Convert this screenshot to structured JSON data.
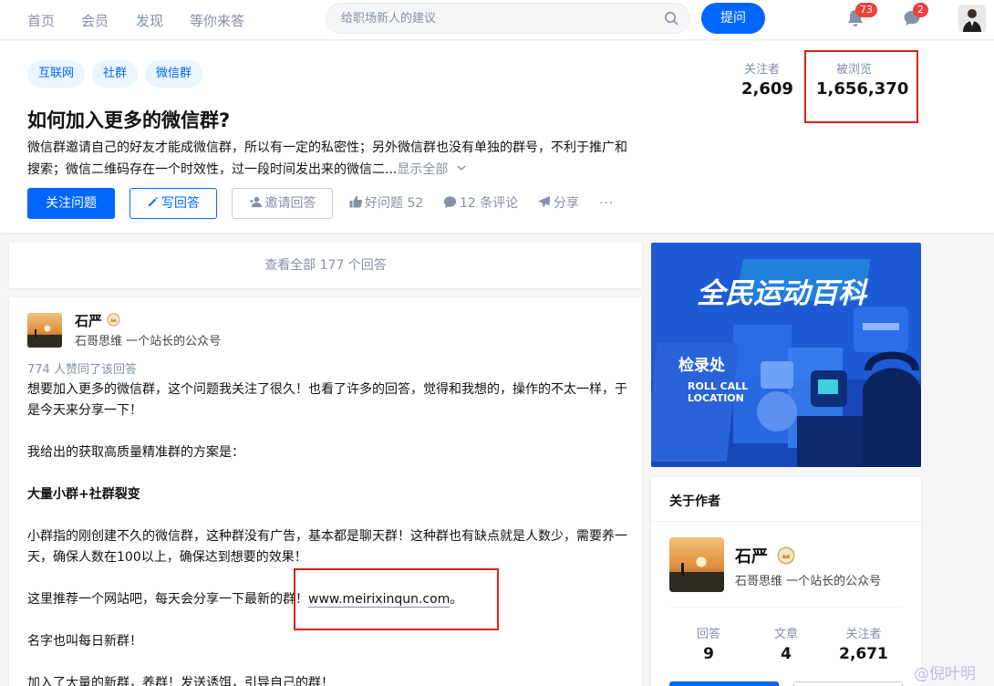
{
  "nav": {
    "links": [
      "首页",
      "会员",
      "发现",
      "等你来答"
    ],
    "search_placeholder": "给职场新人的建议",
    "ask_label": "提问",
    "notifications_count": "73",
    "messages_count": "2"
  },
  "question": {
    "topics": [
      "互联网",
      "社群",
      "微信群"
    ],
    "title": "如何加入更多的微信群?",
    "description": "微信群邀请自己的好友才能成微信群，所以有一定的私密性；另外微信群也没有单独的群号，不利于推广和搜索；微信二维码存在一个时效性，过一段时间发出来的微信二...",
    "show_all": "显示全部",
    "follow_label": "关注问题",
    "write_label": "写回答",
    "invite_label": "邀请回答",
    "upvote_label": "好问题 52",
    "comments_label": "12 条评论",
    "share_label": "分享",
    "more_label": "···",
    "followers_label": "关注者",
    "followers_value": "2,609",
    "views_label": "被浏览",
    "views_value": "1,656,370"
  },
  "answers": {
    "view_all": "查看全部 177 个回答"
  },
  "answer": {
    "author_name": "石严",
    "author_bio": "石哥思维 一个站长的公众号",
    "voters": "774 人赞同了该回答",
    "p1": "想要加入更多的微信群，这个问题我关注了很久！也看了许多的回答，觉得和我想的，操作的不太一样，于是今天来分享一下！",
    "p2": "我给出的获取高质量精准群的方案是：",
    "p3": "大量小群+社群裂变",
    "p4": "小群指的刚创建不久的微信群，这种群没有广告，基本都是聊天群！这种群也有缺点就是人数少，需要养一天，确保人数在100以上，确保达到想要的效果！",
    "p5_prefix": "这里推荐一个网站吧，每天会分享一下最新的群！",
    "p5_link": "www.meirixinqun.com",
    "p5_suffix": "。",
    "p6": "名字也叫每日新群！",
    "p7": "加入了大量的新群，养群！发送诱饵，引导自己的群！"
  },
  "banner": {
    "title": "全民运动百科",
    "sign_top": "检录处",
    "sign_en1": "ROLL CALL",
    "sign_en2": "LOCATION"
  },
  "author_card": {
    "title": "关于作者",
    "name": "石严",
    "bio": "石哥思维 一个站长的公众号",
    "stats": [
      {
        "label": "回答",
        "value": "9"
      },
      {
        "label": "文章",
        "value": "4"
      },
      {
        "label": "关注者",
        "value": "2,671"
      }
    ]
  },
  "watermark": "@倪叶明",
  "colors": {
    "brand": "#0066ff",
    "annotation": "#e02020",
    "badge": "#f1403c"
  }
}
